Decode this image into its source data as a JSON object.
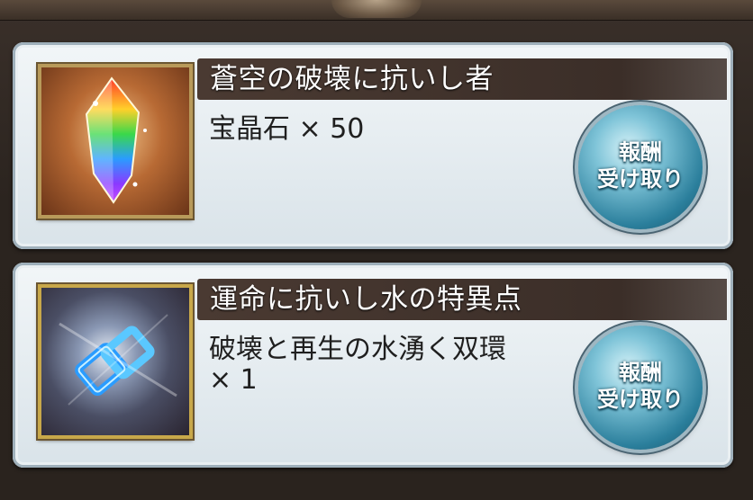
{
  "rewards": [
    {
      "title": "蒼空の破壊に抗いし者",
      "item_line1": "宝晶石 × 50",
      "item_line2": "",
      "icon": "rainbow-crystal-icon"
    },
    {
      "title": "運命に抗いし水の特異点",
      "item_line1": "破壊と再生の水湧く双環",
      "item_line2": "× 1",
      "icon": "water-twin-rings-icon"
    }
  ],
  "button": {
    "line1": "報酬",
    "line2": "受け取り"
  },
  "colors": {
    "card_bg": "#e6edf1",
    "title_bar": "#3e302a",
    "button_accent": "#2b7f9c",
    "frame": "#2a241f"
  }
}
